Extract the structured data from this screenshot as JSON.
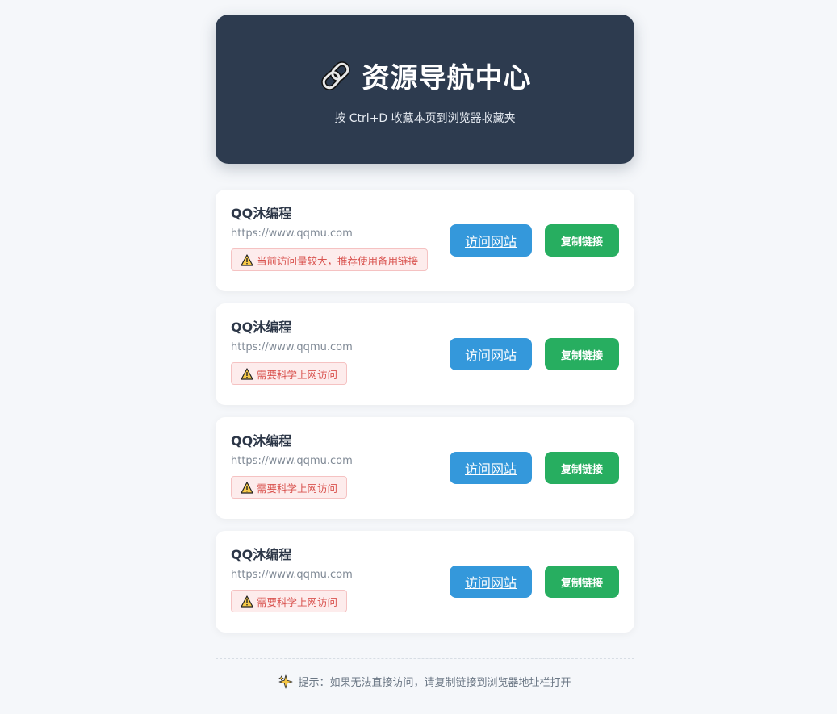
{
  "header": {
    "title": "资源导航中心",
    "title_icon": "link-icon",
    "subtitle": "按 Ctrl+D 收藏本页到浏览器收藏夹"
  },
  "cards": [
    {
      "title": "QQ沐编程",
      "url": "https://www.qqmu.com",
      "warning": "当前访问量较大，推荐使用备用链接",
      "visit_label": "访问网站",
      "copy_label": "复制链接"
    },
    {
      "title": "QQ沐编程",
      "url": "https://www.qqmu.com",
      "warning": "需要科学上网访问",
      "visit_label": "访问网站",
      "copy_label": "复制链接"
    },
    {
      "title": "QQ沐编程",
      "url": "https://www.qqmu.com",
      "warning": "需要科学上网访问",
      "visit_label": "访问网站",
      "copy_label": "复制链接"
    },
    {
      "title": "QQ沐编程",
      "url": "https://www.qqmu.com",
      "warning": "需要科学上网访问",
      "visit_label": "访问网站",
      "copy_label": "复制链接"
    }
  ],
  "footer": {
    "icon": "sparkle-icon",
    "text": "提示：如果无法直接访问，请复制链接到浏览器地址栏打开"
  },
  "colors": {
    "header_bg": "#2d3b4f",
    "visit_button": "#3498db",
    "copy_button": "#27ae60",
    "warning_text": "#d9534f",
    "warning_bg": "#fdecec"
  }
}
